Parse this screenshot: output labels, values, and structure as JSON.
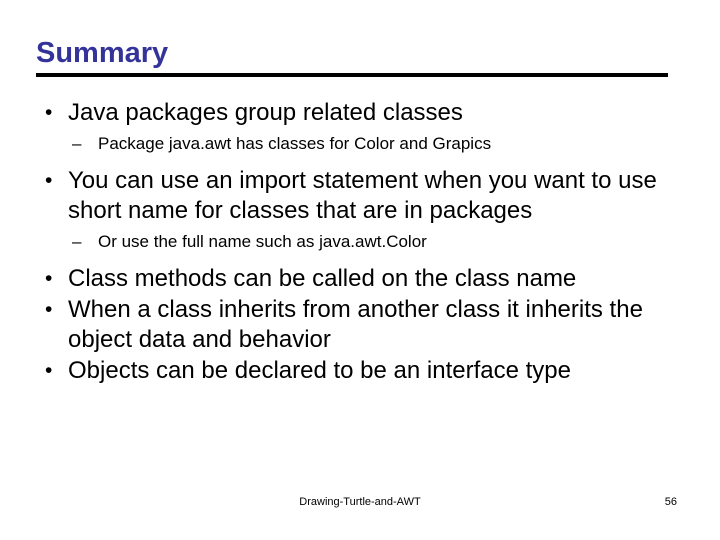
{
  "slide": {
    "title": "Summary",
    "title_color": "#333399",
    "body_color": "#000000",
    "background_color": "#ffffff",
    "bullet_marker": "•",
    "sub_bullet_marker": "–",
    "content": [
      {
        "level": 1,
        "text": "Java packages group related classes"
      },
      {
        "level": 2,
        "text": "Package java.awt has classes for Color and Grapics"
      },
      {
        "level": 1,
        "text": "You can use an import statement when you want to use short name for classes that are in packages"
      },
      {
        "level": 2,
        "text": "Or use the full name such as java.awt.Color"
      },
      {
        "level": 1,
        "text": "Class methods can be called on the class name"
      },
      {
        "level": 1,
        "text": "When a class inherits from another class it inherits the object data and behavior"
      },
      {
        "level": 1,
        "text": "Objects can be declared to be an interface type"
      }
    ],
    "footer": {
      "center_text": "Drawing-Turtle-and-AWT",
      "page_number": "56"
    }
  }
}
